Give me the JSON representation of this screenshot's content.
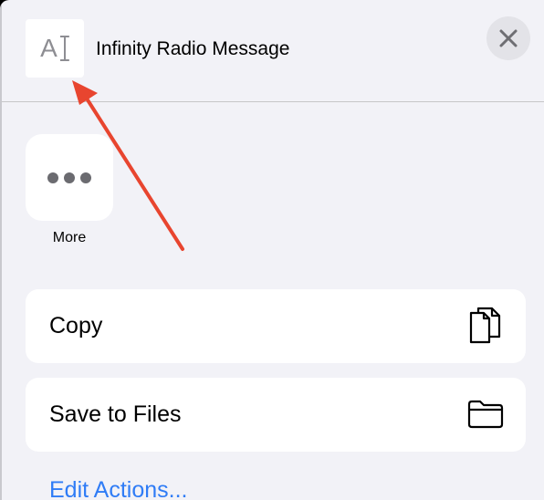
{
  "header": {
    "thumbnail_letter": "A",
    "title": "Infinity Radio Message"
  },
  "actions": {
    "more_label": "More"
  },
  "rows": {
    "copy_label": "Copy",
    "save_label": "Save to Files"
  },
  "footer": {
    "edit_actions_label": "Edit Actions..."
  },
  "colors": {
    "sheet_background": "#f2f2f7",
    "link_blue": "#2f7cf6",
    "annotation_red": "#e8452f"
  },
  "icons": {
    "close": "close-icon",
    "more": "ellipsis-icon",
    "copy": "copy-documents-icon",
    "save": "folder-icon",
    "thumbnail": "text-cursor-icon"
  }
}
